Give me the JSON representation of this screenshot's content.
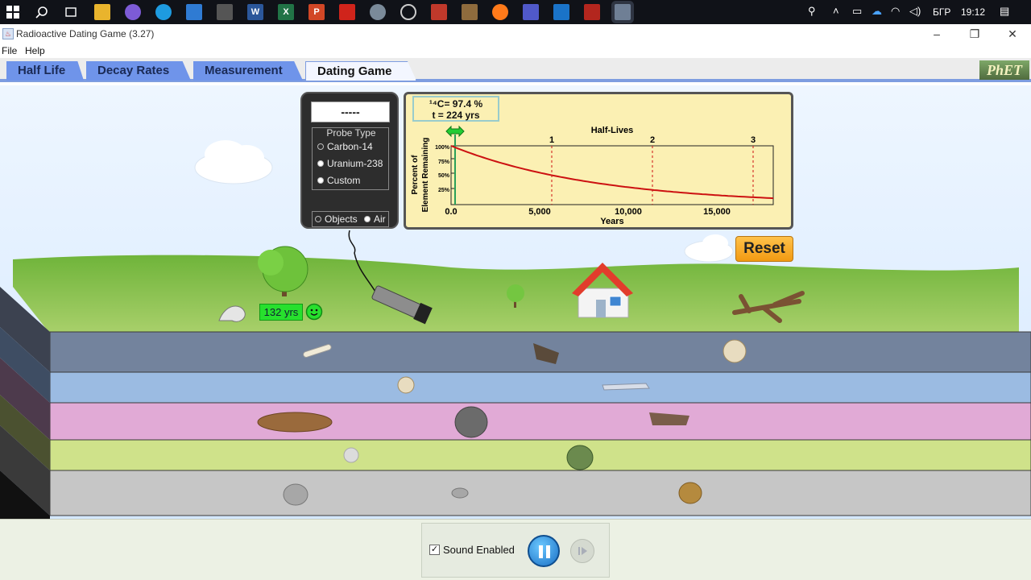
{
  "taskbar": {
    "tray": {
      "language": "БГР",
      "time": "19:12"
    }
  },
  "window": {
    "title": "Radioactive Dating Game (3.27)",
    "menu": [
      "File",
      "Help"
    ]
  },
  "tabs": [
    {
      "label": "Half Life",
      "active": false
    },
    {
      "label": "Decay Rates",
      "active": false
    },
    {
      "label": "Measurement",
      "active": false
    },
    {
      "label": "Dating Game",
      "active": true
    }
  ],
  "logo": "PhET",
  "probe": {
    "readout": "-----",
    "type_title": "Probe Type",
    "types": [
      "Carbon-14",
      "Uranium-238",
      "Custom"
    ],
    "targets": [
      "Objects",
      "Air"
    ]
  },
  "graph": {
    "readout_line1": "¹⁴C= 97.4 %",
    "readout_line2": "t = 224 yrs",
    "half_lives_title": "Half-Lives",
    "half_life_ticks": [
      "1",
      "2",
      "3"
    ],
    "ylabel_line1": "Percent of",
    "ylabel_line2": "Element Remaining",
    "yticks": [
      "100%",
      "75%",
      "50%",
      "25%"
    ],
    "xticks": [
      "0.0",
      "5,000",
      "10,000",
      "15,000"
    ],
    "xlabel": "Years"
  },
  "reset_label": "Reset",
  "age_label": "132 yrs",
  "controls": {
    "sound_label": "Sound Enabled",
    "sound_enabled": true
  },
  "colors": {
    "tab_blue": "#6f94ea",
    "graph_bg": "#fbf0b3",
    "decay_curve": "#cc1111",
    "reset_orange": "#f29a12",
    "age_green": "#27e02d"
  }
}
